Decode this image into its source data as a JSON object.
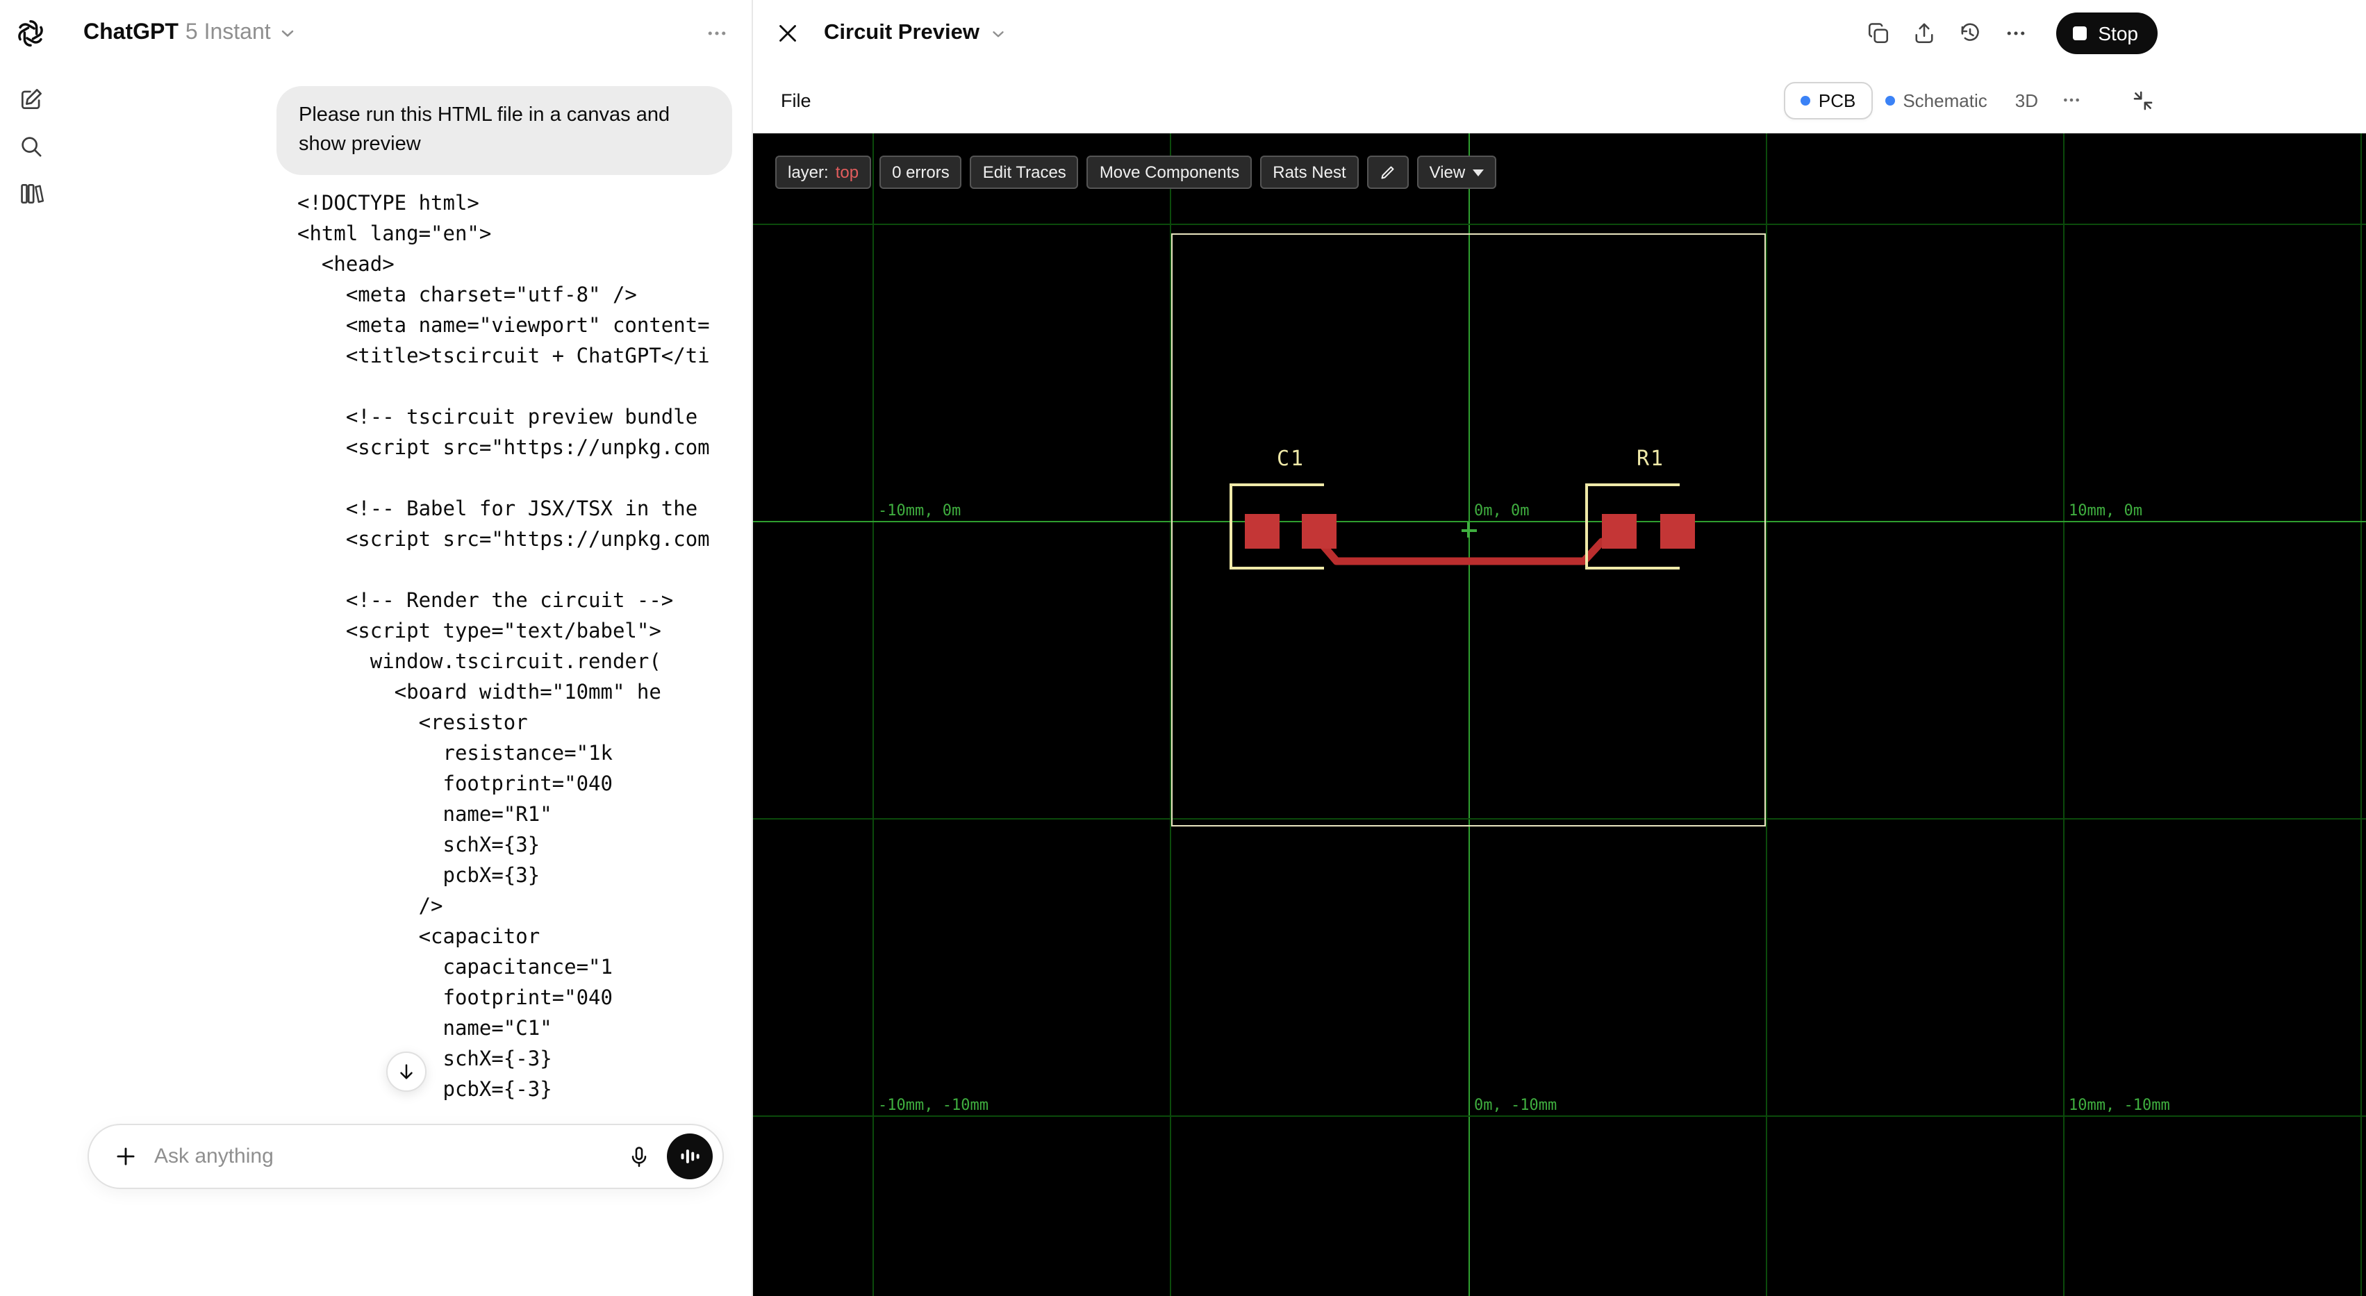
{
  "sidebar": {
    "icons": [
      "openai-logo-icon",
      "new-chat-icon",
      "search-icon",
      "library-icon"
    ]
  },
  "chat": {
    "header": {
      "title": "ChatGPT",
      "model": "5 Instant",
      "menu_icon": "ellipsis-icon"
    },
    "message": {
      "role": "user",
      "text": "Please run this HTML file in a canvas and show preview"
    },
    "code": "<!DOCTYPE html>\n<html lang=\"en\">\n  <head>\n    <meta charset=\"utf-8\" />\n    <meta name=\"viewport\" content=\n    <title>tscircuit + ChatGPT</ti\n\n    <!-- tscircuit preview bundle\n    <script src=\"https://unpkg.com\n\n    <!-- Babel for JSX/TSX in the\n    <script src=\"https://unpkg.com\n\n    <!-- Render the circuit -->\n    <script type=\"text/babel\">\n      window.tscircuit.render(\n        <board width=\"10mm\" he\n          <resistor\n            resistance=\"1k\n            footprint=\"040\n            name=\"R1\"\n            schX={3}\n            pcbX={3}\n          />\n          <capacitor\n            capacitance=\"1\n            footprint=\"040\n            name=\"C1\"\n            schX={-3}\n            pcbX={-3}",
    "scroll_button_icon": "arrow-down-icon",
    "composer": {
      "placeholder": "Ask anything",
      "icons": [
        "plus-icon",
        "microphone-icon",
        "voice-waveform-icon"
      ]
    }
  },
  "canvas": {
    "header": {
      "title": "Circuit Preview",
      "stop_label": "Stop",
      "icons": [
        "copy-icon",
        "share-icon",
        "history-icon",
        "ellipsis-icon"
      ]
    },
    "menubar": {
      "file_label": "File",
      "tabs": [
        {
          "label": "PCB",
          "active": true,
          "dot": true
        },
        {
          "label": "Schematic",
          "active": false,
          "dot": true
        },
        {
          "label": "3D",
          "active": false,
          "dot": false
        }
      ],
      "overflow_icon": "ellipsis-icon",
      "fullscreen_icon": "compress-icon"
    },
    "toolbar": {
      "layer_label": "layer:",
      "layer_value": "top",
      "errors_label": "0 errors",
      "edit_traces": "Edit Traces",
      "move_components": "Move Components",
      "rats_nest": "Rats Nest",
      "pencil_icon": "pencil-icon",
      "view_label": "View"
    },
    "pcb": {
      "components": [
        {
          "ref": "C1"
        },
        {
          "ref": "R1"
        }
      ],
      "grid_labels": [
        "-10mm, 0m",
        "0m, 0m",
        "10mm, 0m",
        "-10mm, -10mm",
        "0m, -10mm",
        "10mm, -10mm"
      ],
      "colors": {
        "pad": "#c43636",
        "trace": "#bb2e2e",
        "silkscreen": "#efe9a8",
        "board_outline": "#e9e5c0",
        "grid_minor": "#0b4a0b",
        "grid_axis": "#2f9e2f",
        "grid_label": "#3fae3f",
        "background": "#000000",
        "accent_blue": "#3b82f6",
        "layer_red": "#e25d5d"
      }
    }
  }
}
